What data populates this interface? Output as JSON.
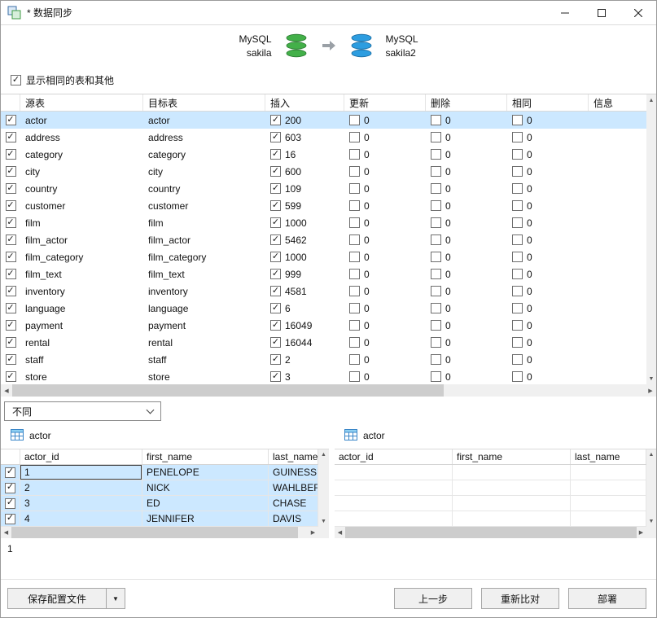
{
  "window": {
    "title": "* 数据同步"
  },
  "colors": {
    "selection": "#cce8ff",
    "source_db": "#43b049",
    "target_db": "#2d9de0"
  },
  "header": {
    "source": {
      "engine": "MySQL",
      "database": "sakila"
    },
    "target": {
      "engine": "MySQL",
      "database": "sakila2"
    },
    "show_identical_label": "显示相同的表和其他"
  },
  "table": {
    "columns": [
      "源表",
      "目标表",
      "插入",
      "更新",
      "删除",
      "相同",
      "信息"
    ],
    "rows": [
      {
        "source": "actor",
        "target": "actor",
        "insert": "200",
        "update": "0",
        "delete": "0",
        "identical": "0",
        "selected": true
      },
      {
        "source": "address",
        "target": "address",
        "insert": "603",
        "update": "0",
        "delete": "0",
        "identical": "0",
        "selected": false
      },
      {
        "source": "category",
        "target": "category",
        "insert": "16",
        "update": "0",
        "delete": "0",
        "identical": "0",
        "selected": false
      },
      {
        "source": "city",
        "target": "city",
        "insert": "600",
        "update": "0",
        "delete": "0",
        "identical": "0",
        "selected": false
      },
      {
        "source": "country",
        "target": "country",
        "insert": "109",
        "update": "0",
        "delete": "0",
        "identical": "0",
        "selected": false
      },
      {
        "source": "customer",
        "target": "customer",
        "insert": "599",
        "update": "0",
        "delete": "0",
        "identical": "0",
        "selected": false
      },
      {
        "source": "film",
        "target": "film",
        "insert": "1000",
        "update": "0",
        "delete": "0",
        "identical": "0",
        "selected": false
      },
      {
        "source": "film_actor",
        "target": "film_actor",
        "insert": "5462",
        "update": "0",
        "delete": "0",
        "identical": "0",
        "selected": false
      },
      {
        "source": "film_category",
        "target": "film_category",
        "insert": "1000",
        "update": "0",
        "delete": "0",
        "identical": "0",
        "selected": false
      },
      {
        "source": "film_text",
        "target": "film_text",
        "insert": "999",
        "update": "0",
        "delete": "0",
        "identical": "0",
        "selected": false
      },
      {
        "source": "inventory",
        "target": "inventory",
        "insert": "4581",
        "update": "0",
        "delete": "0",
        "identical": "0",
        "selected": false
      },
      {
        "source": "language",
        "target": "language",
        "insert": "6",
        "update": "0",
        "delete": "0",
        "identical": "0",
        "selected": false
      },
      {
        "source": "payment",
        "target": "payment",
        "insert": "16049",
        "update": "0",
        "delete": "0",
        "identical": "0",
        "selected": false
      },
      {
        "source": "rental",
        "target": "rental",
        "insert": "16044",
        "update": "0",
        "delete": "0",
        "identical": "0",
        "selected": false
      },
      {
        "source": "staff",
        "target": "staff",
        "insert": "2",
        "update": "0",
        "delete": "0",
        "identical": "0",
        "selected": false
      },
      {
        "source": "store",
        "target": "store",
        "insert": "3",
        "update": "0",
        "delete": "0",
        "identical": "0",
        "selected": false
      }
    ]
  },
  "filter": {
    "value": "不同"
  },
  "detail_left": {
    "table_name": "actor",
    "columns": [
      "actor_id",
      "first_name",
      "last_name"
    ],
    "rows": [
      [
        "1",
        "PENELOPE",
        "GUINESS"
      ],
      [
        "2",
        "NICK",
        "WAHLBERG"
      ],
      [
        "3",
        "ED",
        "CHASE"
      ],
      [
        "4",
        "JENNIFER",
        "DAVIS"
      ]
    ]
  },
  "detail_right": {
    "table_name": "actor",
    "columns": [
      "actor_id",
      "first_name",
      "last_name"
    ],
    "empty_rows": 4
  },
  "status": {
    "count": "1"
  },
  "footer": {
    "save_button": "保存配置文件",
    "prev_button": "上一步",
    "recompare_button": "重新比对",
    "deploy_button": "部署"
  }
}
